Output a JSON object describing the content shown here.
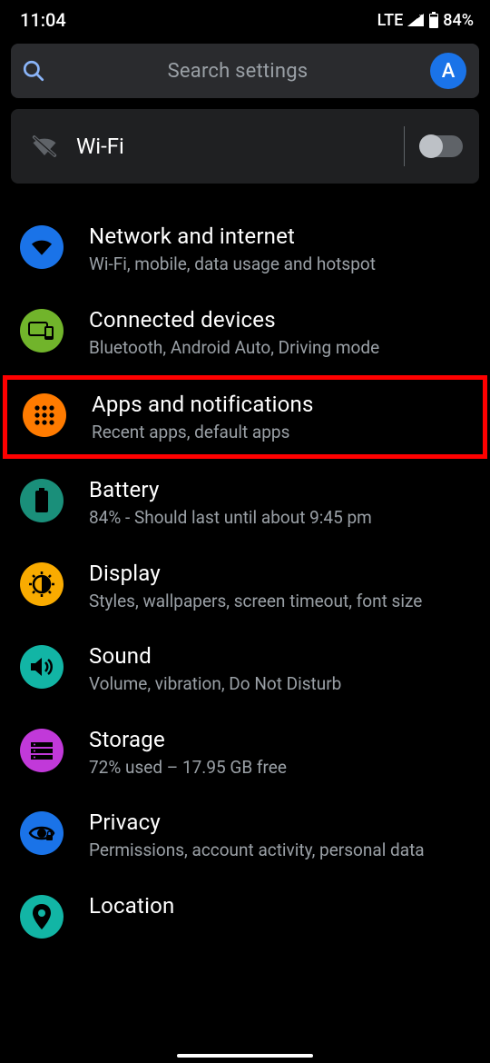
{
  "status": {
    "time": "11:04",
    "network": "LTE",
    "battery": "84%"
  },
  "search": {
    "placeholder": "Search settings",
    "avatar_letter": "A"
  },
  "wifi_tile": {
    "label": "Wi-Fi",
    "enabled": false
  },
  "items": [
    {
      "title": "Network and internet",
      "sub": "Wi-Fi, mobile, data usage and hotspot",
      "icon": "wifi",
      "color": "#1a73e8",
      "highlighted": false
    },
    {
      "title": "Connected devices",
      "sub": "Bluetooth, Android Auto, Driving mode",
      "icon": "devices",
      "color": "#71b42b",
      "highlighted": false
    },
    {
      "title": "Apps and notifications",
      "sub": "Recent apps, default apps",
      "icon": "apps",
      "color": "#ff7b00",
      "highlighted": true
    },
    {
      "title": "Battery",
      "sub": "84% - Should last until about 9:45 pm",
      "icon": "battery",
      "color": "#1a8f7a",
      "highlighted": false
    },
    {
      "title": "Display",
      "sub": "Styles, wallpapers, screen timeout, font size",
      "icon": "display",
      "color": "#f9ab00",
      "highlighted": false
    },
    {
      "title": "Sound",
      "sub": "Volume, vibration, Do Not Disturb",
      "icon": "sound",
      "color": "#12b5a5",
      "highlighted": false
    },
    {
      "title": "Storage",
      "sub": "72% used – 17.95 GB free",
      "icon": "storage",
      "color": "#c139d9",
      "highlighted": false
    },
    {
      "title": "Privacy",
      "sub": "Permissions, account activity, personal data",
      "icon": "privacy",
      "color": "#1a73e8",
      "highlighted": false
    },
    {
      "title": "Location",
      "sub": "",
      "icon": "location",
      "color": "#12b5a5",
      "highlighted": false
    }
  ]
}
